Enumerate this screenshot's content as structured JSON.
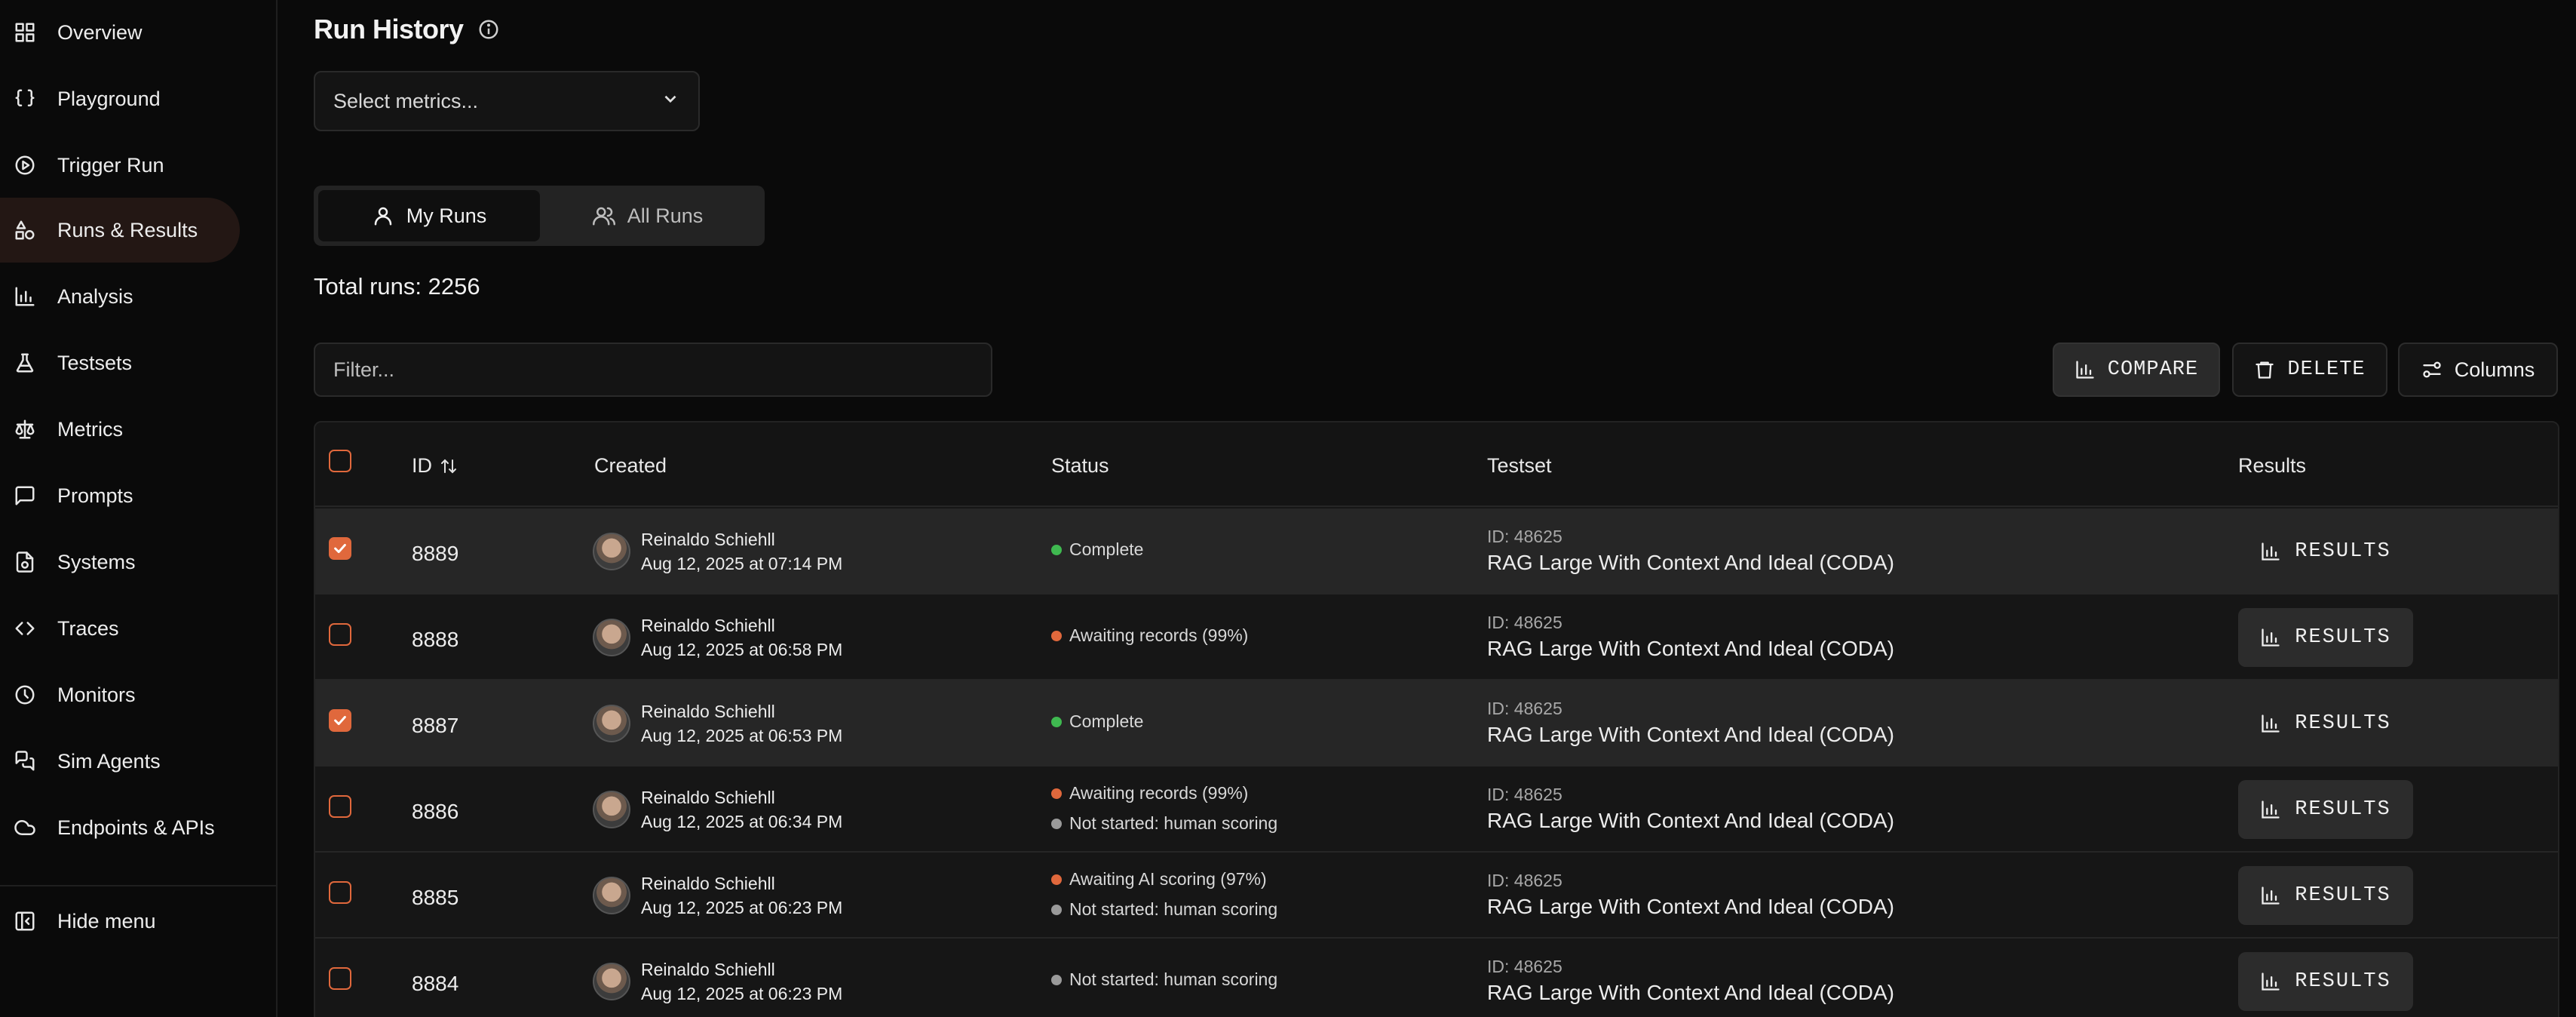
{
  "sidebar": {
    "items": [
      {
        "label": "Overview",
        "icon": "grid-icon"
      },
      {
        "label": "Playground",
        "icon": "braces-icon"
      },
      {
        "label": "Trigger Run",
        "icon": "play-circle-icon"
      },
      {
        "label": "Runs & Results",
        "icon": "shapes-icon",
        "active": true
      },
      {
        "label": "Analysis",
        "icon": "bar-chart-icon"
      },
      {
        "label": "Testsets",
        "icon": "flask-icon"
      },
      {
        "label": "Metrics",
        "icon": "scale-icon"
      },
      {
        "label": "Prompts",
        "icon": "chat-icon"
      },
      {
        "label": "Systems",
        "icon": "file-settings-icon"
      },
      {
        "label": "Traces",
        "icon": "code-icon"
      },
      {
        "label": "Monitors",
        "icon": "clock-icon"
      },
      {
        "label": "Sim Agents",
        "icon": "chat-bubbles-icon"
      },
      {
        "label": "Endpoints & APIs",
        "icon": "cloud-icon"
      }
    ],
    "hide_menu": "Hide menu"
  },
  "header": {
    "title": "Run History"
  },
  "metrics_select": {
    "placeholder": "Select metrics..."
  },
  "toggle": {
    "my_runs": "My Runs",
    "all_runs": "All Runs"
  },
  "total_runs": "Total runs: 2256",
  "filter": {
    "placeholder": "Filter..."
  },
  "toolbar": {
    "compare": "COMPARE",
    "delete": "DELETE",
    "columns": "Columns"
  },
  "table": {
    "headers": {
      "id": "ID",
      "created": "Created",
      "status": "Status",
      "testset": "Testset",
      "results": "Results"
    },
    "rows": [
      {
        "id": "8889",
        "user": "Reinaldo Schiehll",
        "date": "Aug 12, 2025 at 07:14 PM",
        "checked": true,
        "statuses": [
          {
            "text": "Complete",
            "color": "#3fb950"
          }
        ],
        "testset_id": "ID: 48625",
        "testset_name": "RAG Large With Context And Ideal (CODA)",
        "results": "RESULTS"
      },
      {
        "id": "8888",
        "user": "Reinaldo Schiehll",
        "date": "Aug 12, 2025 at 06:58 PM",
        "checked": false,
        "statuses": [
          {
            "text": "Awaiting records (99%)",
            "color": "#e0683c"
          }
        ],
        "testset_id": "ID: 48625",
        "testset_name": "RAG Large With Context And Ideal (CODA)",
        "results": "RESULTS"
      },
      {
        "id": "8887",
        "user": "Reinaldo Schiehll",
        "date": "Aug 12, 2025 at 06:53 PM",
        "checked": true,
        "statuses": [
          {
            "text": "Complete",
            "color": "#3fb950"
          }
        ],
        "testset_id": "ID: 48625",
        "testset_name": "RAG Large With Context And Ideal (CODA)",
        "results": "RESULTS"
      },
      {
        "id": "8886",
        "user": "Reinaldo Schiehll",
        "date": "Aug 12, 2025 at 06:34 PM",
        "checked": false,
        "statuses": [
          {
            "text": "Awaiting records (99%)",
            "color": "#e0683c"
          },
          {
            "text": "Not started: human scoring",
            "color": "#9a9a9a"
          }
        ],
        "testset_id": "ID: 48625",
        "testset_name": "RAG Large With Context And Ideal (CODA)",
        "results": "RESULTS"
      },
      {
        "id": "8885",
        "user": "Reinaldo Schiehll",
        "date": "Aug 12, 2025 at 06:23 PM",
        "checked": false,
        "statuses": [
          {
            "text": "Awaiting AI scoring (97%)",
            "color": "#e0683c"
          },
          {
            "text": "Not started: human scoring",
            "color": "#9a9a9a"
          }
        ],
        "testset_id": "ID: 48625",
        "testset_name": "RAG Large With Context And Ideal (CODA)",
        "results": "RESULTS"
      },
      {
        "id": "8884",
        "user": "Reinaldo Schiehll",
        "date": "Aug 12, 2025 at 06:23 PM",
        "checked": false,
        "statuses": [
          {
            "text": "Not started: human scoring",
            "color": "#9a9a9a"
          }
        ],
        "testset_id": "ID: 48625",
        "testset_name": "RAG Large With Context And Ideal (CODA)",
        "results": "RESULTS"
      }
    ]
  }
}
